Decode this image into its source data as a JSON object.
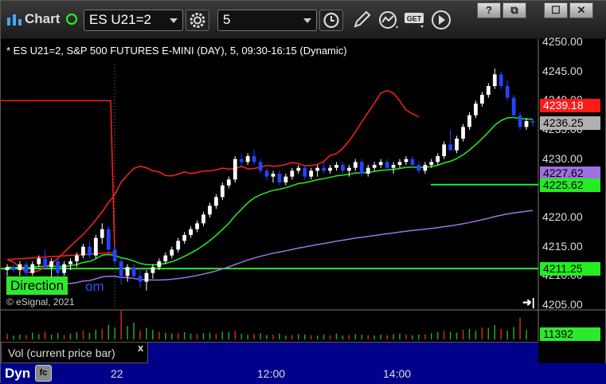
{
  "toolbar": {
    "app_label": "Chart",
    "symbol": "ES U21=2",
    "interval": "5",
    "icons": [
      "gear-icon",
      "clock-icon",
      "pencil-icon",
      "study-icon",
      "get-icon",
      "play-icon",
      "help-icon",
      "restore-icon",
      "maximize-icon",
      "close-icon"
    ],
    "window_controls": [
      "?",
      "⧉",
      "☐",
      "✕"
    ]
  },
  "chart": {
    "title": "* ES U21=2, S&P 500 FUTURES E-MINI (DAY), 5, 09:30-16:15 (Dynamic)",
    "copyright": "© eSignal, 2021",
    "direction_label": "Direction",
    "direction_tail": "om",
    "colors": {
      "background": "#000000",
      "up_candle": "#ffffff",
      "down_candle": "#2244ff",
      "red_ma": "#ff2020",
      "green_ma": "#22ee22",
      "purple_vwap": "#a070e0",
      "green_level": "#22ee22",
      "volume_bar": "#dd2222"
    }
  },
  "price_axis": {
    "ticks": [
      "4250.00",
      "4245.00",
      "4240.00",
      "4235.00",
      "4230.00",
      "4225.00",
      "4220.00",
      "4215.00",
      "4210.00",
      "4205.00"
    ],
    "markers": [
      {
        "value": "4239.18",
        "color": "#ff1a1a",
        "text_color": "#ffffff"
      },
      {
        "value": "4236.25",
        "color": "#b0b0b0",
        "text_color": "#000000"
      },
      {
        "value": "4227.62",
        "color": "#a070e0",
        "text_color": "#000000"
      },
      {
        "value": "4225.62",
        "color": "#22ee22",
        "text_color": "#000000"
      },
      {
        "value": "4211.25",
        "color": "#22ee22",
        "text_color": "#000000"
      }
    ]
  },
  "volume": {
    "label": "Vol (current price bar)",
    "close_label": "x",
    "value": "11392"
  },
  "time_axis": {
    "dyn_label": "Dyn",
    "dyn_icon": "fc",
    "labels": [
      "22",
      "12:00",
      "14:00"
    ]
  },
  "chart_data": {
    "type": "candlestick",
    "ylim": [
      4205,
      4250
    ],
    "price_axis_side": "right",
    "grid": false,
    "candles": [
      [
        4211.0,
        4212.0,
        4210.0,
        4211.5
      ],
      [
        4211.5,
        4212.0,
        4210.5,
        4211.0
      ],
      [
        4211.0,
        4212.5,
        4210.0,
        4212.0
      ],
      [
        4212.0,
        4212.5,
        4210.0,
        4210.5
      ],
      [
        4210.5,
        4212.5,
        4210.0,
        4212.0
      ],
      [
        4212.0,
        4213.5,
        4211.5,
        4213.0
      ],
      [
        4213.0,
        4214.5,
        4211.0,
        4211.5
      ],
      [
        4211.5,
        4213.0,
        4209.5,
        4212.5
      ],
      [
        4212.5,
        4213.0,
        4210.0,
        4210.5
      ],
      [
        4210.5,
        4212.5,
        4210.0,
        4212.0
      ],
      [
        4212.0,
        4213.0,
        4211.0,
        4212.5
      ],
      [
        4212.5,
        4214.0,
        4211.5,
        4213.5
      ],
      [
        4213.5,
        4215.5,
        4213.0,
        4215.0
      ],
      [
        4215.0,
        4216.0,
        4213.0,
        4213.5
      ],
      [
        4213.5,
        4217.0,
        4213.0,
        4216.5
      ],
      [
        4216.5,
        4219.0,
        4215.5,
        4218.0
      ],
      [
        4218.0,
        4218.5,
        4214.0,
        4214.5
      ],
      [
        4214.5,
        4215.0,
        4212.0,
        4212.5
      ],
      [
        4212.5,
        4213.0,
        4208.5,
        4210.0
      ],
      [
        4210.0,
        4212.0,
        4209.0,
        4211.5
      ],
      [
        4211.5,
        4212.0,
        4209.5,
        4210.0
      ],
      [
        4210.0,
        4211.5,
        4208.0,
        4209.0
      ],
      [
        4209.0,
        4211.0,
        4207.5,
        4210.5
      ],
      [
        4210.5,
        4212.0,
        4209.5,
        4211.5
      ],
      [
        4211.5,
        4213.0,
        4211.0,
        4212.5
      ],
      [
        4212.5,
        4214.0,
        4212.0,
        4213.5
      ],
      [
        4213.5,
        4215.0,
        4213.0,
        4214.5
      ],
      [
        4214.5,
        4216.5,
        4214.0,
        4216.0
      ],
      [
        4216.0,
        4217.5,
        4215.5,
        4217.0
      ],
      [
        4217.0,
        4218.5,
        4216.5,
        4218.0
      ],
      [
        4218.0,
        4219.5,
        4217.5,
        4219.0
      ],
      [
        4219.0,
        4221.0,
        4218.5,
        4220.5
      ],
      [
        4220.5,
        4222.5,
        4220.0,
        4222.0
      ],
      [
        4222.0,
        4224.0,
        4221.5,
        4223.5
      ],
      [
        4223.5,
        4226.0,
        4223.0,
        4225.5
      ],
      [
        4225.5,
        4227.0,
        4225.0,
        4226.5
      ],
      [
        4226.5,
        4230.5,
        4226.0,
        4230.0
      ],
      [
        4230.0,
        4231.0,
        4228.5,
        4229.5
      ],
      [
        4229.5,
        4231.0,
        4229.0,
        4230.5
      ],
      [
        4230.5,
        4231.5,
        4229.0,
        4229.5
      ],
      [
        4229.5,
        4230.0,
        4227.5,
        4228.0
      ],
      [
        4228.0,
        4228.5,
        4226.5,
        4227.0
      ],
      [
        4227.0,
        4228.0,
        4226.0,
        4227.5
      ],
      [
        4227.5,
        4228.0,
        4225.5,
        4226.0
      ],
      [
        4226.0,
        4227.5,
        4225.5,
        4227.0
      ],
      [
        4227.0,
        4228.5,
        4226.5,
        4228.0
      ],
      [
        4228.0,
        4229.0,
        4227.5,
        4228.5
      ],
      [
        4228.5,
        4229.0,
        4226.5,
        4227.0
      ],
      [
        4227.0,
        4228.5,
        4226.5,
        4228.0
      ],
      [
        4228.0,
        4229.0,
        4227.0,
        4228.5
      ],
      [
        4228.5,
        4229.5,
        4227.5,
        4228.0
      ],
      [
        4228.0,
        4229.0,
        4227.5,
        4228.5
      ],
      [
        4228.5,
        4229.5,
        4228.0,
        4229.0
      ],
      [
        4229.0,
        4229.5,
        4227.5,
        4228.0
      ],
      [
        4228.0,
        4229.0,
        4227.0,
        4228.5
      ],
      [
        4228.5,
        4230.0,
        4228.0,
        4229.5
      ],
      [
        4229.5,
        4230.0,
        4227.0,
        4227.5
      ],
      [
        4227.5,
        4229.0,
        4227.0,
        4228.5
      ],
      [
        4228.5,
        4229.5,
        4228.0,
        4229.0
      ],
      [
        4229.0,
        4230.0,
        4228.5,
        4229.5
      ],
      [
        4229.5,
        4230.0,
        4228.0,
        4228.5
      ],
      [
        4228.5,
        4229.5,
        4227.5,
        4229.0
      ],
      [
        4229.0,
        4230.0,
        4228.5,
        4229.5
      ],
      [
        4229.5,
        4230.5,
        4229.0,
        4230.0
      ],
      [
        4230.0,
        4230.5,
        4228.5,
        4229.0
      ],
      [
        4229.0,
        4229.5,
        4227.5,
        4228.0
      ],
      [
        4228.0,
        4229.5,
        4227.5,
        4229.0
      ],
      [
        4229.0,
        4230.0,
        4228.5,
        4229.5
      ],
      [
        4229.5,
        4231.0,
        4229.0,
        4230.5
      ],
      [
        4230.5,
        4233.0,
        4230.0,
        4232.5
      ],
      [
        4232.5,
        4235.0,
        4231.5,
        4231.5
      ],
      [
        4231.5,
        4234.0,
        4231.0,
        4233.5
      ],
      [
        4233.5,
        4236.0,
        4233.0,
        4235.5
      ],
      [
        4235.5,
        4238.0,
        4235.0,
        4237.5
      ],
      [
        4237.5,
        4240.0,
        4237.0,
        4239.5
      ],
      [
        4239.5,
        4241.5,
        4239.0,
        4241.0
      ],
      [
        4241.0,
        4243.0,
        4240.5,
        4242.5
      ],
      [
        4242.5,
        4245.5,
        4242.0,
        4244.5
      ],
      [
        4244.5,
        4245.0,
        4242.0,
        4242.5
      ],
      [
        4242.5,
        4243.5,
        4240.0,
        4240.5
      ],
      [
        4240.5,
        4241.0,
        4237.0,
        4237.5
      ],
      [
        4237.5,
        4238.0,
        4235.0,
        4235.5
      ],
      [
        4235.5,
        4237.0,
        4235.0,
        4236.5
      ],
      [
        4236.5,
        4237.0,
        4235.5,
        4236.25
      ]
    ],
    "volume": [
      12,
      8,
      10,
      9,
      14,
      11,
      16,
      10,
      13,
      9,
      12,
      15,
      18,
      14,
      20,
      22,
      30,
      25,
      60,
      28,
      35,
      18,
      24,
      20,
      16,
      14,
      12,
      13,
      15,
      12,
      11,
      13,
      14,
      12,
      16,
      15,
      18,
      12,
      10,
      11,
      13,
      9,
      10,
      12,
      8,
      9,
      11,
      10,
      9,
      8,
      10,
      9,
      12,
      8,
      9,
      11,
      10,
      9,
      8,
      10,
      9,
      11,
      12,
      10,
      9,
      10,
      11,
      13,
      15,
      18,
      16,
      14,
      20,
      22,
      18,
      25,
      24,
      30,
      22,
      18,
      26,
      45,
      20
    ],
    "levels": [
      {
        "name": "Direction",
        "value": 4211.25
      },
      {
        "value": 4225.62
      }
    ]
  }
}
